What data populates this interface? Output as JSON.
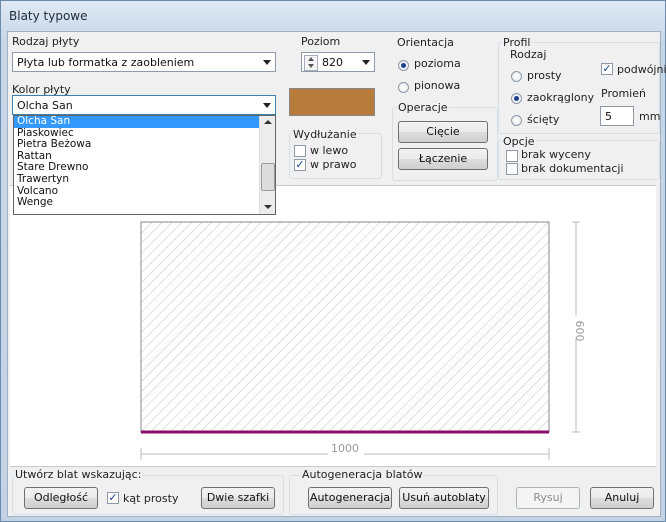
{
  "window": {
    "title": "Blaty typowe"
  },
  "rodzaj": {
    "label": "Rodzaj płyty",
    "value": "Płyta lub formatka z zaobleniem"
  },
  "poziom": {
    "label": "Poziom",
    "value": "820"
  },
  "orientacja": {
    "label": "Orientacja",
    "options": [
      "pozioma",
      "pionowa"
    ],
    "selected": "pozioma"
  },
  "operacje": {
    "label": "Operacje",
    "ciecie": "Cięcie",
    "laczenie": "Łączenie"
  },
  "profil": {
    "label": "Profil",
    "rodzaj_label": "Rodzaj",
    "options": [
      "prosty",
      "zaokrąglony",
      "ścięty"
    ],
    "selected": "zaokrąglony",
    "podwojnie": "podwójnie",
    "promien_label": "Promień",
    "promien_value": "5",
    "unit": "mm"
  },
  "kolor": {
    "label": "Kolor płyty",
    "value": "Olcha San",
    "swatch": "#b77b3b",
    "items": [
      "Olcha San",
      "Piaskowiec",
      "Pietra Beżowa",
      "Rattan",
      "Stare Drewno",
      "Trawertyn",
      "Volcano",
      "Wenge"
    ],
    "selected_index": 0
  },
  "wydluzanie": {
    "label": "Wydłużanie",
    "w_lewo": "w lewo",
    "w_prawo": "w prawo",
    "w_prawo_checked": true,
    "w_lewo_checked": false
  },
  "opcje": {
    "label": "Opcje",
    "brak_wyceny": "brak wyceny",
    "brak_dokumentacji": "brak dokumentacji"
  },
  "drawing": {
    "width_label": "1000",
    "height_label": "600",
    "edge_color": "#8b0a6e"
  },
  "utworz": {
    "label": "Utwórz blat wskazując:",
    "odleglosc": "Odległość",
    "kat_prosty": "kąt prosty",
    "dwie_szafki": "Dwie szafki"
  },
  "autogen": {
    "label": "Autogeneracja blatów",
    "autogeneracja": "Autogeneracja",
    "usun": "Usuń autoblaty"
  },
  "footer": {
    "rysuj": "Rysuj",
    "anuluj": "Anuluj"
  }
}
